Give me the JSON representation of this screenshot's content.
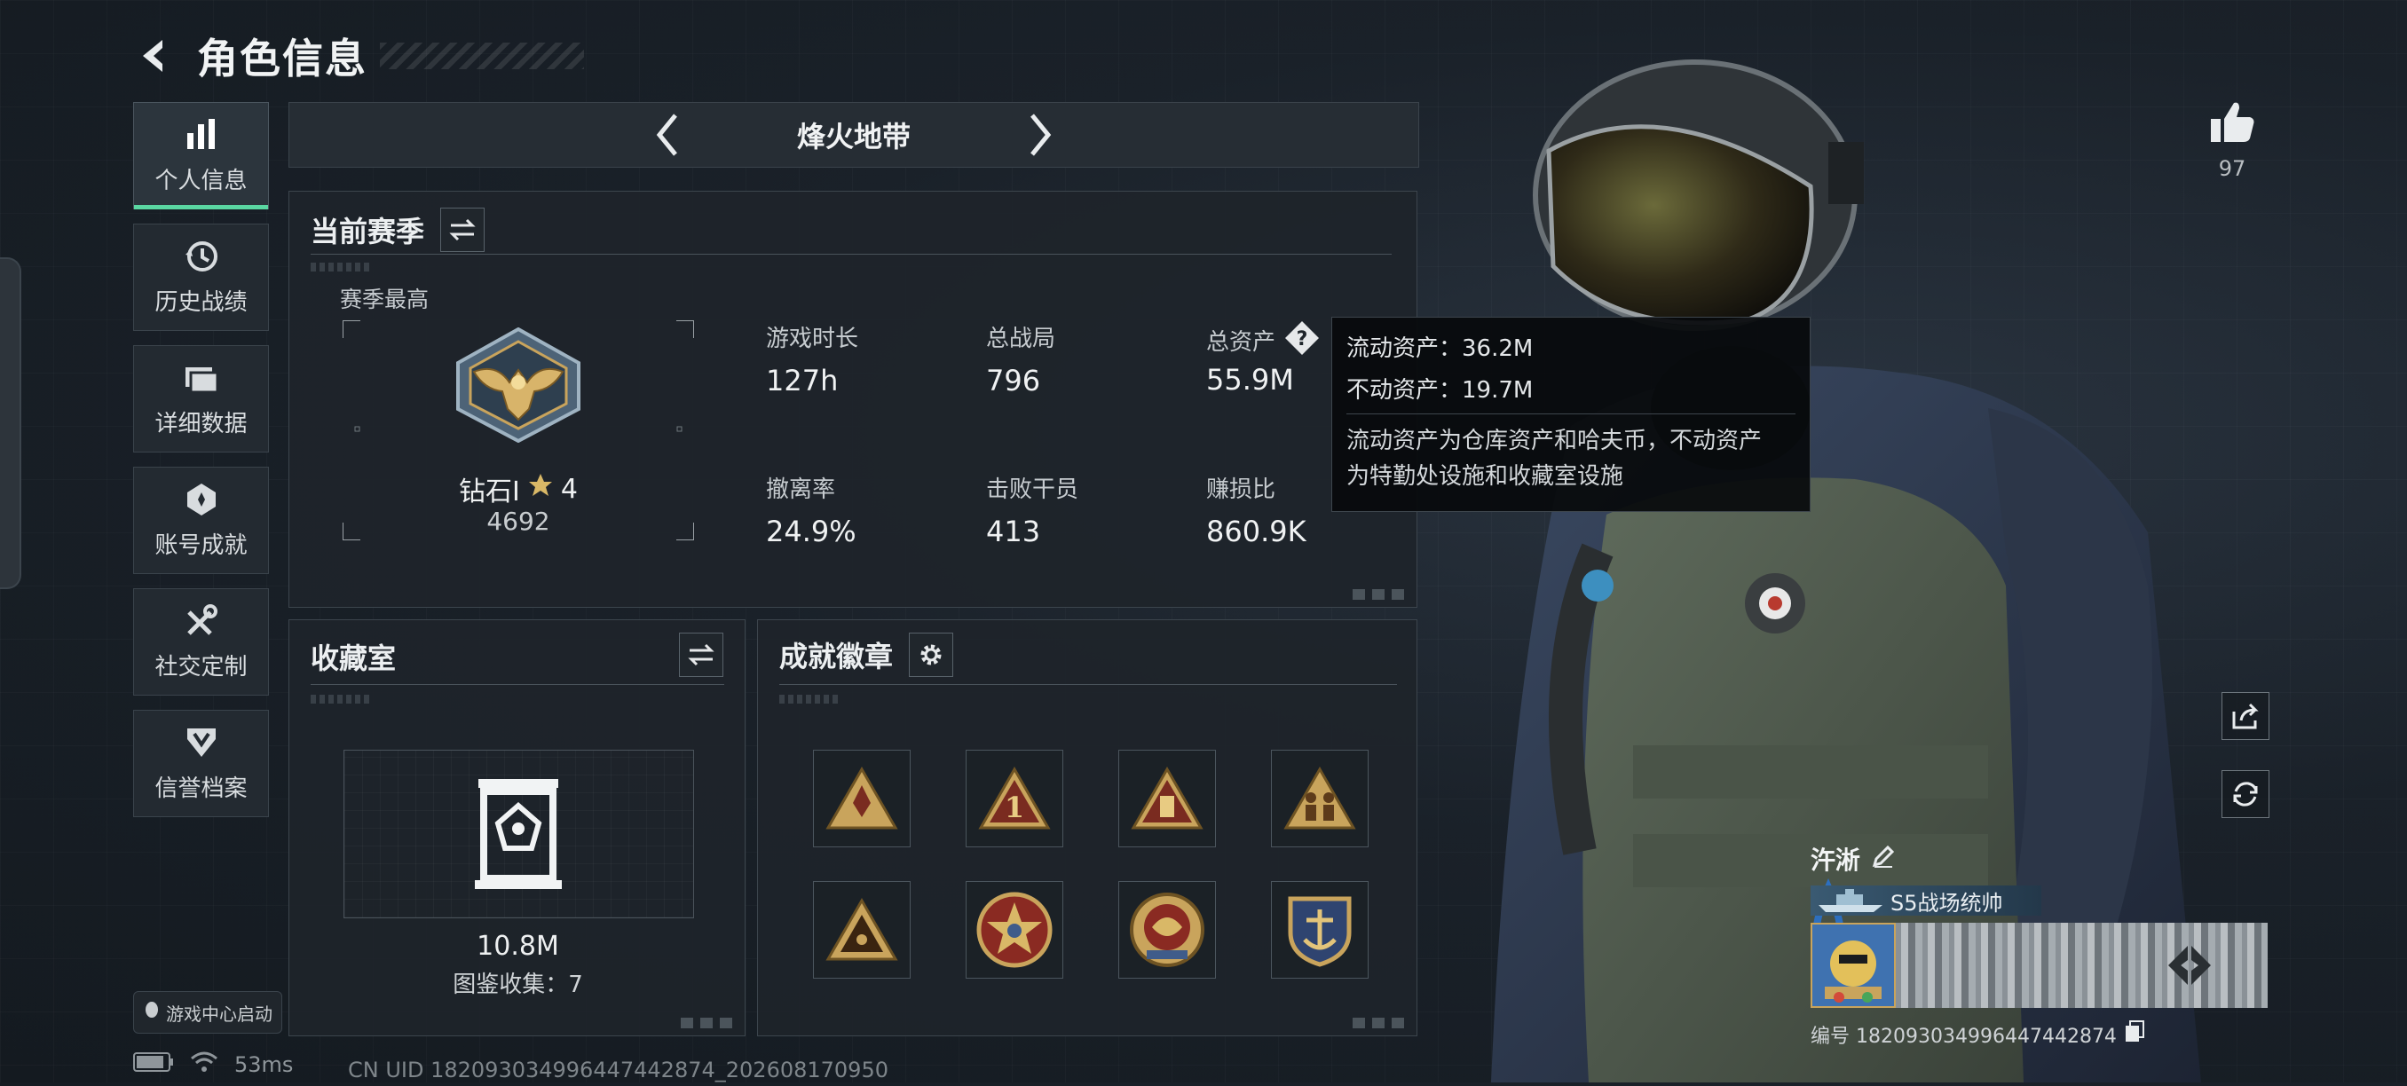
{
  "header": {
    "title": "角色信息"
  },
  "sidebar": {
    "items": [
      {
        "label": "个人信息",
        "active": true,
        "icon": "bar-chart-icon"
      },
      {
        "label": "历史战绩",
        "active": false,
        "icon": "history-icon"
      },
      {
        "label": "详细数据",
        "active": false,
        "icon": "folder-icon"
      },
      {
        "label": "账号成就",
        "active": false,
        "icon": "achievement-icon"
      },
      {
        "label": "社交定制",
        "active": false,
        "icon": "tools-icon"
      },
      {
        "label": "信誉档案",
        "active": false,
        "icon": "shield-icon"
      }
    ],
    "game_center": "游戏中心启动"
  },
  "status": {
    "ping": "53ms",
    "uid": "CN UID 182093034996447442874_202608170950"
  },
  "mode": {
    "name": "烽火地带"
  },
  "season": {
    "title": "当前赛季",
    "best_label": "赛季最高",
    "rank_name": "钻石I",
    "rank_stars": "4",
    "rank_score": "4692",
    "stats": [
      {
        "label": "游戏时长",
        "value": "127h"
      },
      {
        "label": "总战局",
        "value": "796"
      },
      {
        "label": "总资产",
        "value": "55.9M"
      },
      {
        "label": "撤离率",
        "value": "24.9%"
      },
      {
        "label": "击败干员",
        "value": "413"
      },
      {
        "label": "赚损比",
        "value": "860.9K"
      }
    ]
  },
  "tooltip": {
    "liquid": "流动资产：36.2M",
    "fixed": "不动资产：19.7M",
    "desc_line1": "流动资产为仓库资产和哈夫币，不动资产",
    "desc_line2": "为特勤处设施和收藏室设施"
  },
  "collection": {
    "title": "收藏室",
    "value": "10.8M",
    "count_text": "图鉴收集：7"
  },
  "badges": {
    "title": "成就徽章",
    "items": [
      "triangle-badge-icon",
      "number-one-badge-icon",
      "tower-badge-icon",
      "soldiers-badge-icon",
      "eye-triangle-badge-icon",
      "star-shield-badge-icon",
      "laurel-badge-icon",
      "anchor-shield-badge-icon"
    ]
  },
  "profile": {
    "likes": "97",
    "name": "汻淅",
    "title_tag": "S5战场统帅",
    "id_text": "编号 182093034996447442874"
  },
  "colors": {
    "accent": "#5ad7a2",
    "gold": "#c9a45c",
    "panel": "#1e242a"
  }
}
